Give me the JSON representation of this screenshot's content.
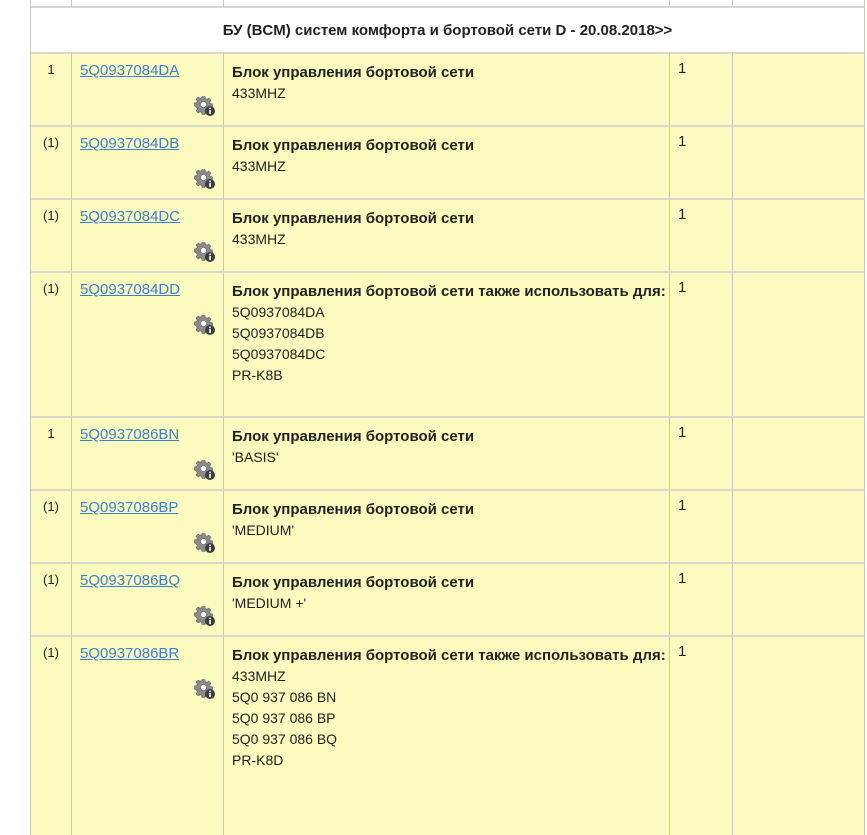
{
  "header": {
    "title": "БУ (BCM) систем комфорта и бортовой сети D - 20.08.2018>>"
  },
  "rows": [
    {
      "qty": "1",
      "part": "5Q0937084DA",
      "title": "Блок управления бортовой сети",
      "lines": [
        "433MHZ"
      ],
      "count": "1"
    },
    {
      "qty": "(1)",
      "part": "5Q0937084DB",
      "title": "Блок управления бортовой сети",
      "lines": [
        "433MHZ"
      ],
      "count": "1"
    },
    {
      "qty": "(1)",
      "part": "5Q0937084DC",
      "title": "Блок управления бортовой сети",
      "lines": [
        "433MHZ"
      ],
      "count": "1"
    },
    {
      "qty": "(1)",
      "part": "5Q0937084DD",
      "title": "Блок управления бортовой сети также использовать для:",
      "lines": [
        "5Q0937084DA",
        "5Q0937084DB",
        "5Q0937084DC",
        "PR-K8B"
      ],
      "count": "1"
    },
    {
      "qty": "1",
      "part": "5Q0937086BN",
      "title": "Блок управления бортовой сети",
      "lines": [
        "'BASIS'"
      ],
      "count": "1"
    },
    {
      "qty": "(1)",
      "part": "5Q0937086BP",
      "title": "Блок управления бортовой сети",
      "lines": [
        "'MEDIUM'"
      ],
      "count": "1"
    },
    {
      "qty": "(1)",
      "part": "5Q0937086BQ",
      "title": "Блок управления бортовой сети",
      "lines": [
        "'MEDIUM +'"
      ],
      "count": "1"
    },
    {
      "qty": "(1)",
      "part": "5Q0937086BR",
      "title": "Блок управления бортовой сети также использовать для:",
      "lines": [
        "433MHZ",
        "5Q0 937 086 BN",
        "5Q0 937 086 BP",
        "5Q0 937 086 BQ",
        "PR-K8D"
      ],
      "count": "1"
    }
  ],
  "icons": {
    "row_action": "gear-info-icon"
  },
  "colors": {
    "row_bg": "#fbfbbf",
    "link": "#3f7fd1",
    "border": "#c9c9b6"
  }
}
